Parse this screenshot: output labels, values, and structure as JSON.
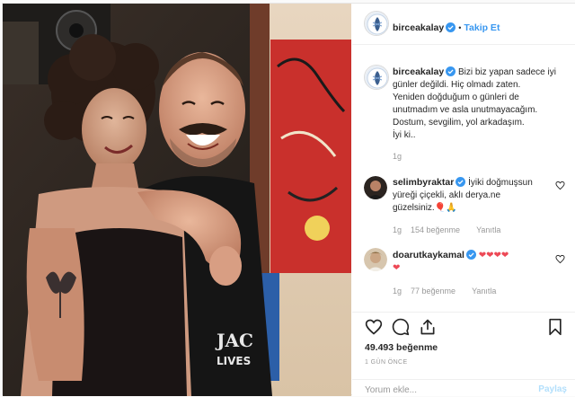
{
  "header": {
    "username": "birceakalay",
    "separator": "•",
    "follow_label": "Takip Et"
  },
  "caption": {
    "username": "birceakalay",
    "lines": [
      "Bizi biz yapan sadece iyi",
      "günler değildi. Hiç olmadı zaten.",
      "Yeniden doğduğum o günleri de",
      "unutmadım ve asla unutmayacağım.",
      "Dostum, sevgilim, yol arkadaşım.",
      "İyi ki.."
    ],
    "time": "1g"
  },
  "comments": [
    {
      "username": "selimbyraktar",
      "lines": [
        "İyiki doğmuşsun",
        "yüreği çiçekli, aklı derya.ne",
        "güzelsiniz.🎈🙏"
      ],
      "time": "1g",
      "likes": "154 beğenme",
      "reply": "Yanıtla"
    },
    {
      "username": "doarutkaykamal",
      "lines": [
        "❤❤❤❤",
        "❤"
      ],
      "time": "1g",
      "likes": "77 beğenme",
      "reply": "Yanıtla"
    }
  ],
  "actions": {
    "likes_count": "49.493 beğenme",
    "time_ago": "1 GÜN ÖNCE"
  },
  "comment_box": {
    "placeholder": "Yorum ekle...",
    "share_label": "Paylaş"
  },
  "photo": {
    "shirt_text_1": "JAC",
    "shirt_text_2": "LIVES"
  },
  "colors": {
    "accent": "#3897f0",
    "heart_red": "#ed4956",
    "verified_blue": "#3897f0"
  },
  "icons": [
    "verified-badge-icon",
    "heart-icon",
    "comment-icon",
    "share-icon",
    "bookmark-icon"
  ]
}
